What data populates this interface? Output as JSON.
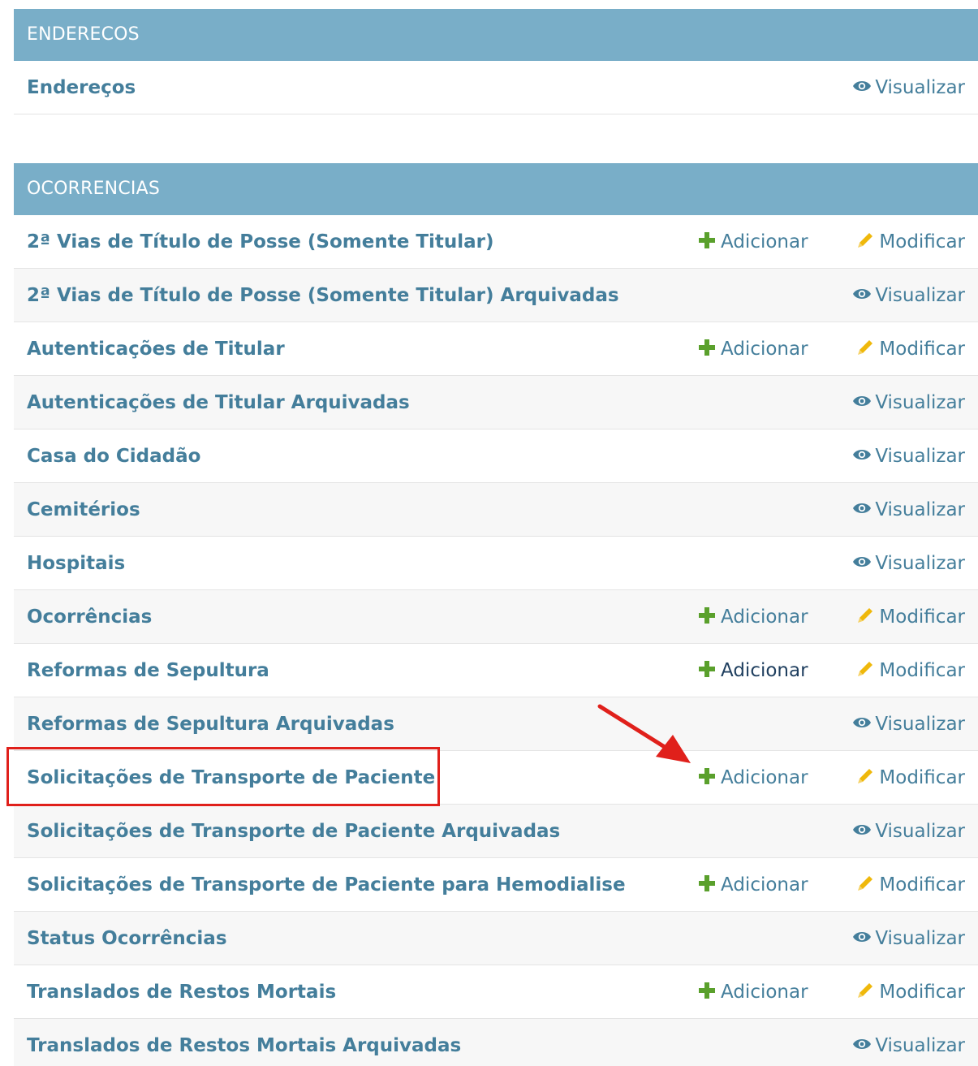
{
  "modules": [
    {
      "caption": "ENDERECOS",
      "rows": [
        {
          "title": "Endereços",
          "actions": [
            "view"
          ]
        }
      ]
    },
    {
      "caption": "OCORRENCIAS",
      "rows": [
        {
          "title": "2ª Vias de Título de Posse (Somente Titular)",
          "actions": [
            "add",
            "change"
          ]
        },
        {
          "title": "2ª Vias de Título de Posse (Somente Titular) Arquivadas",
          "actions": [
            "view"
          ]
        },
        {
          "title": "Autenticações de Titular",
          "actions": [
            "add",
            "change"
          ]
        },
        {
          "title": "Autenticações de Titular Arquivadas",
          "actions": [
            "view"
          ]
        },
        {
          "title": "Casa do Cidadão",
          "actions": [
            "view"
          ]
        },
        {
          "title": "Cemitérios",
          "actions": [
            "view"
          ]
        },
        {
          "title": "Hospitais",
          "actions": [
            "view"
          ]
        },
        {
          "title": "Ocorrências",
          "actions": [
            "add",
            "change"
          ]
        },
        {
          "title": "Reformas de Sepultura",
          "actions": [
            "add",
            "change"
          ]
        },
        {
          "title": "Reformas de Sepultura Arquivadas",
          "actions": [
            "view"
          ]
        },
        {
          "title": "Solicitações de Transporte de Paciente",
          "actions": [
            "add",
            "change"
          ]
        },
        {
          "title": "Solicitações de Transporte de Paciente Arquivadas",
          "actions": [
            "view"
          ]
        },
        {
          "title": "Solicitações de Transporte de Paciente para Hemodialise",
          "actions": [
            "add",
            "change"
          ]
        },
        {
          "title": "Status Ocorrências",
          "actions": [
            "view"
          ]
        },
        {
          "title": "Translados de Restos Mortais",
          "actions": [
            "add",
            "change"
          ]
        },
        {
          "title": "Translados de Restos Mortais Arquivadas",
          "actions": [
            "view"
          ]
        }
      ]
    }
  ],
  "labels": {
    "add": "Adicionar",
    "change": "Modificar",
    "view": "Visualizar"
  },
  "icons": {
    "add": "plus-icon",
    "change": "pencil-icon",
    "view": "eye-icon"
  },
  "colors": {
    "caption_bg": "#79aec8",
    "link": "#447e9b",
    "add_icon": "#5aa02c",
    "change_icon": "#efb80b",
    "view_icon": "#447e9b",
    "annotation": "#e0201b"
  }
}
